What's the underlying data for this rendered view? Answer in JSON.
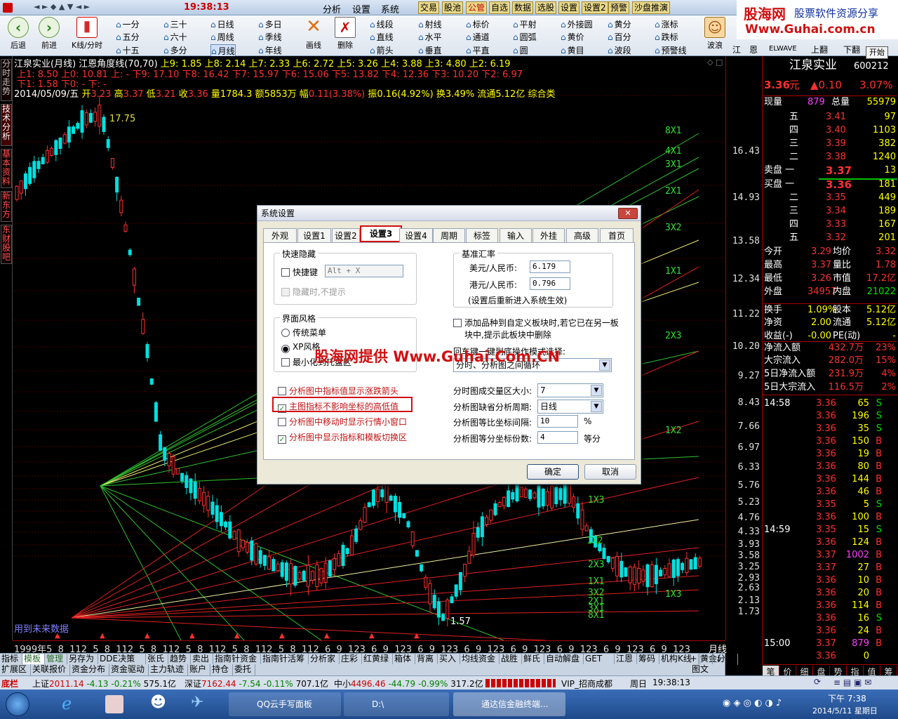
{
  "titlebar": {
    "clock": "19:38:13",
    "menus": [
      "分析",
      "设置",
      "系统"
    ],
    "buttons": [
      "交易",
      "股池",
      "公管",
      "自选",
      "数据",
      "选股",
      "设置",
      "设置2",
      "预警",
      "沙盘推演"
    ]
  },
  "toolbar": {
    "big": [
      {
        "label": "后退",
        "icon": "back-icon"
      },
      {
        "label": "前进",
        "icon": "forward-icon"
      },
      {
        "label": "K线/分时",
        "icon": "kline-icon"
      }
    ],
    "periods": [
      "一分",
      "三十",
      "日线",
      "多日",
      "五分",
      "六十",
      "周线",
      "季线",
      "十五",
      "多分",
      "月线",
      "年线"
    ],
    "draw": [
      {
        "label": "画线",
        "icon": "draw-icon"
      },
      {
        "label": "删除",
        "icon": "delete-icon"
      }
    ],
    "tools": [
      "线段",
      "射线",
      "标价",
      "平射",
      "外接圆",
      "黄分",
      "涨标",
      "直线",
      "水平",
      "通道",
      "圆弧",
      "黄价",
      "百分",
      "跌标",
      "箭头",
      "垂直",
      "平直",
      "圆",
      "黄目",
      "波段",
      "预警线"
    ],
    "right": [
      "波浪",
      "江",
      "恩",
      "ELWAVE",
      "上翻",
      "下翻"
    ],
    "start": "开始"
  },
  "watermark": {
    "site": "股海网",
    "slogan": "股票软件资源分享",
    "url": "Www.Guhai.com.cn"
  },
  "chart": {
    "header1": "江泉实业(月线) 江恩角度线(70,70)",
    "header1_levels": "上9: 1.85 上8: 2.14 上7: 2.33 上6: 2.72 上5: 3.26 上4: 3.88 上3: 4.80 上2: 6.19",
    "header2": "上1: 8.50 上0: 10.81 上: - 下9: 17.10 下8: 16.42 下7: 15.97 下6: 15.06 下5: 13.82 下4: 12.36 下3: 10.20 下2: 6.97",
    "header3": "下1: 1.58 下0: - 下: -",
    "info": {
      "date": "2014/05/09/五",
      "open_l": "开",
      "open": "3.23",
      "high_l": "高",
      "high": "3.37",
      "low_l": "低",
      "low": "3.21",
      "close_l": "收",
      "close": "3.36",
      "vol_l": "量",
      "vol": "1784.3",
      "amt_l": "额",
      "amt": "5853万",
      "chg_l": "幅",
      "chg": "0.11(3.38%)",
      "amp_l": "振",
      "amp": "0.16(4.92%)",
      "turn_l": "换",
      "turn": "3.49%",
      "float_l": "流通",
      "float": "5.12亿",
      "sector": "综合类"
    },
    "peak_label": "17.75",
    "low_label": "1.57",
    "future_note": "用到未来数据",
    "fan_labels": [
      "8X1",
      "4X1",
      "3X1",
      "2X1",
      "3X2",
      "1X1",
      "2X3",
      "1X2"
    ],
    "fan_labels2": [
      "1X3",
      "1X2",
      "2X3",
      "1X1",
      "3X2",
      "2X1",
      "3X1",
      "8X1",
      "1X3"
    ],
    "yticks": [
      "16.43",
      "14.93",
      "13.58",
      "12.34",
      "11.22",
      "10.20",
      "9.27",
      "8.43",
      "7.66",
      "6.97",
      "6.33",
      "5.76",
      "5.23",
      "4.76",
      "4.33",
      "3.93",
      "3.58",
      "3.25",
      "2.93",
      "2.63",
      "2.13",
      "1.73"
    ],
    "xaxis": "1999年5  8  112  5  8  112  5  8  112  5  8  112  5  8  112  5  8  112  6  9  123  6  9  123  6  9  123  6  9  123  6  9  123  6  9  123  6  9  123  6  9  123",
    "period": "月线"
  },
  "left_tabs": [
    "分时走势",
    "技术分析",
    "基本资料",
    "新东方",
    "东财股吧"
  ],
  "funcbar": [
    "指标",
    "模板",
    "管理",
    "另存为",
    "DDE决策",
    "张氏",
    "趋势",
    "卖出",
    "指南针资金",
    "指南针活筹",
    "分析家",
    "庄彩",
    "红黄绿",
    "箱体",
    "背离",
    "买入",
    "均线资金",
    "战胜",
    "鲜氏",
    "自动解盘",
    "GET",
    "江恩",
    "筹码",
    "机构K线",
    "黄金分割"
  ],
  "funcbar_right": [
    "+",
    "-",
    "↓"
  ],
  "funcbar2": [
    "扩展区",
    "关联报价",
    "资金分布",
    "资金驱动",
    "主力轨迹",
    "账户",
    "持仓",
    "委托"
  ],
  "funcbar2_right": "图文F10",
  "panel": {
    "name": "江泉实业",
    "code": "600212",
    "price": "3.36",
    "unit": "元",
    "change": "▲0.10",
    "pct": "3.07%",
    "now_l": "现量",
    "now": "879",
    "total_l": "总量",
    "total": "55979",
    "asks": [
      {
        "l": "五",
        "p": "3.41",
        "v": "97"
      },
      {
        "l": "四",
        "p": "3.40",
        "v": "1103"
      },
      {
        "l": "三",
        "p": "3.39",
        "v": "382"
      },
      {
        "l": "二",
        "p": "3.38",
        "v": "1240"
      },
      {
        "l": "卖盘 一",
        "p": "3.37",
        "v": "13"
      }
    ],
    "bids": [
      {
        "l": "买盘 一",
        "p": "3.36",
        "v": "181"
      },
      {
        "l": "二",
        "p": "3.35",
        "v": "449"
      },
      {
        "l": "三",
        "p": "3.34",
        "v": "189"
      },
      {
        "l": "四",
        "p": "3.33",
        "v": "167"
      },
      {
        "l": "五",
        "p": "3.32",
        "v": "201"
      }
    ],
    "stats": [
      {
        "a": "今开",
        "av": "3.29",
        "b": "均价",
        "bv": "3.32"
      },
      {
        "a": "最高",
        "av": "3.37",
        "b": "量比",
        "bv": "1.78"
      },
      {
        "a": "最低",
        "av": "3.26",
        "b": "市值",
        "bv": "17.2亿"
      },
      {
        "a": "外盘",
        "av": "34957",
        "b": "内盘",
        "bv": "21022"
      },
      {
        "a": "换手",
        "av": "1.09%",
        "b": "股本",
        "bv": "5.12亿"
      },
      {
        "a": "净资",
        "av": "2.00",
        "b": "流通",
        "bv": "5.12亿"
      },
      {
        "a": "收益(-)",
        "av": "-0.00",
        "b": "PE(动)",
        "bv": "-"
      }
    ],
    "flows": [
      {
        "l": "净流入额",
        "v": "432.7万",
        "p": "23%"
      },
      {
        "l": "大宗流入",
        "v": "282.0万",
        "p": "15%"
      },
      {
        "l": "5日净流入额",
        "v": "231.9万",
        "p": "4%"
      },
      {
        "l": "5日大宗流入",
        "v": "116.5万",
        "p": "2%"
      }
    ],
    "ticks": [
      {
        "t": "14:58",
        "p": "3.36",
        "v": "65",
        "s": "S"
      },
      {
        "t": "",
        "p": "3.36",
        "v": "196",
        "s": "S"
      },
      {
        "t": "",
        "p": "3.36",
        "v": "35",
        "s": "S"
      },
      {
        "t": "",
        "p": "3.36",
        "v": "150",
        "s": "B"
      },
      {
        "t": "",
        "p": "3.36",
        "v": "19",
        "s": "B"
      },
      {
        "t": "",
        "p": "3.36",
        "v": "80",
        "s": "B"
      },
      {
        "t": "",
        "p": "3.36",
        "v": "144",
        "s": "B"
      },
      {
        "t": "",
        "p": "3.36",
        "v": "46",
        "s": "B"
      },
      {
        "t": "",
        "p": "3.35",
        "v": "5",
        "s": "S"
      },
      {
        "t": "",
        "p": "3.36",
        "v": "100",
        "s": "B"
      },
      {
        "t": "14:59",
        "p": "3.35",
        "v": "15",
        "s": "S"
      },
      {
        "t": "",
        "p": "3.36",
        "v": "124",
        "s": "B"
      },
      {
        "t": "",
        "p": "3.37",
        "v": "1002",
        "s": "B"
      },
      {
        "t": "",
        "p": "3.37",
        "v": "27",
        "s": "B"
      },
      {
        "t": "",
        "p": "3.36",
        "v": "10",
        "s": "B"
      },
      {
        "t": "",
        "p": "3.36",
        "v": "20",
        "s": "B"
      },
      {
        "t": "",
        "p": "3.36",
        "v": "114",
        "s": "B"
      },
      {
        "t": "",
        "p": "3.36",
        "v": "16",
        "s": "S"
      },
      {
        "t": "",
        "p": "3.36",
        "v": "24",
        "s": "B"
      },
      {
        "t": "15:00",
        "p": "3.37",
        "v": "879",
        "s": "B"
      },
      {
        "t": "",
        "p": "3.36",
        "v": "0",
        "s": ""
      }
    ],
    "bottom_tabs": [
      "笔",
      "价",
      "细",
      "盘",
      "势",
      "指",
      "值",
      "筹"
    ]
  },
  "status": {
    "bar": "底栏",
    "sh_l": "上证",
    "sh": "2011.14",
    "sh_c": "-4.13",
    "sh_p": "-0.21%",
    "sh_a": "575.1亿",
    "sz_l": "深证",
    "sz": "7162.44",
    "sz_c": "-7.54",
    "sz_p": "-0.11%",
    "sz_a": "707.1亿",
    "zx_l": "中小",
    "zx": "4496.46",
    "zx_c": "-44.79",
    "zx_p": "-0.99%",
    "zx_a": "317.2亿",
    "vip": "VIP_招商成都",
    "day": "周日",
    "time": "19:38:13"
  },
  "taskbar": {
    "tasks": [
      "QQ云手写面板",
      "D:\\",
      "通达信金融终端..."
    ],
    "time": "下午 7:38",
    "date": "2014/5/11 星期日"
  },
  "dialog": {
    "title": "系统设置",
    "tabs": [
      "外观",
      "设置1",
      "设置2",
      "设置3",
      "设置4",
      "周期",
      "标签",
      "输入",
      "外挂",
      "高级",
      "首页"
    ],
    "quick_hide": {
      "legend": "快速隐藏",
      "hotkey_label": "快捷键",
      "hotkey_value": "Alt + X",
      "no_prompt": "隐藏时,不提示"
    },
    "exchange": {
      "legend": "基准汇率",
      "usd_label": "美元/人民币:",
      "usd": "6.179",
      "hkd_label": "港元/人民币:",
      "hkd": "0.796",
      "note": "(设置后重新进入系统生效)"
    },
    "style": {
      "legend": "界面风格",
      "classic": "传统菜单",
      "xp": "XP风格",
      "minimize": "最小化到托盘区"
    },
    "add_block": "添加品种到自定义板块时,若它已在另一板块中,提示此板块中删除",
    "enter_label": "回车键一键到底操作模式选择:",
    "enter_value": "分时、分析图之间循环",
    "promo": "股海网提供 Www.Guhai.Com.CN",
    "checks": [
      {
        "label": "分析图中指标值显示涨跌箭头",
        "checked": false
      },
      {
        "label": "主图指标不影响坐标的高低值",
        "checked": true
      },
      {
        "label": "分析图中移动时显示行情小窗口",
        "checked": false
      },
      {
        "label": "分析图中显示指标和模板切换区",
        "checked": true
      }
    ],
    "right_fields": [
      {
        "label": "分时图成交量区大小:",
        "value": "7",
        "type": "select"
      },
      {
        "label": "分析图缺省分析周期:",
        "value": "日线",
        "type": "select"
      },
      {
        "label": "分析图等比坐标间隔:",
        "value": "10",
        "suffix": "%",
        "type": "input"
      },
      {
        "label": "分析图等分坐标份数:",
        "value": "4",
        "suffix": "等分",
        "type": "input"
      }
    ],
    "ok": "确定",
    "cancel": "取消"
  }
}
